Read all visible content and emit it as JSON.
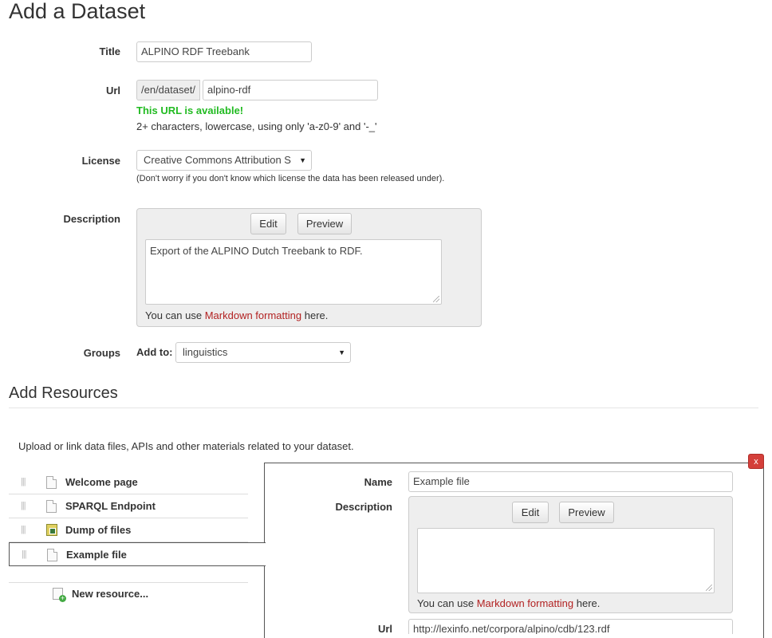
{
  "page_title": "Add a Dataset",
  "form": {
    "title_label": "Title",
    "title_value": "ALPINO RDF Treebank",
    "url_label": "Url",
    "url_prefix": "/en/dataset/",
    "url_value": "alpino-rdf",
    "url_available": "This URL is available!",
    "url_hint": "2+ characters, lowercase, using only 'a-z0-9' and '-_'",
    "license_label": "License",
    "license_value": "Creative Commons Attribution S",
    "license_hint": "(Don't worry if you don't know which license the data has been released under).",
    "description_label": "Description",
    "edit_label": "Edit",
    "preview_label": "Preview",
    "description_value": "Export of the ALPINO Dutch Treebank to RDF.",
    "markdown_prefix": "You can use",
    "markdown_link": "Markdown formatting",
    "markdown_suffix": "here.",
    "groups_label": "Groups",
    "add_to_label": "Add to:",
    "group_value": "linguistics"
  },
  "resources": {
    "heading": "Add Resources",
    "intro": "Upload or link data files, APIs and other materials related to your dataset.",
    "items": [
      {
        "label": "Welcome page",
        "icon": "file-icon"
      },
      {
        "label": "SPARQL Endpoint",
        "icon": "file-icon"
      },
      {
        "label": "Dump of files",
        "icon": "archive-icon"
      },
      {
        "label": "Example file",
        "icon": "file-icon"
      }
    ],
    "new_resource": "New resource...",
    "close_label": "x",
    "editor": {
      "name_label": "Name",
      "name_value": "Example file",
      "description_label": "Description",
      "edit_label": "Edit",
      "preview_label": "Preview",
      "description_value": "",
      "markdown_prefix": "You can use",
      "markdown_link": "Markdown formatting",
      "markdown_suffix": "here.",
      "url_label": "Url",
      "url_value": "http://lexinfo.net/corpora/alpino/cdb/123.rdf"
    }
  },
  "colors": {
    "success": "#22bb22",
    "link": "#b22222",
    "close": "#d43f3a"
  }
}
